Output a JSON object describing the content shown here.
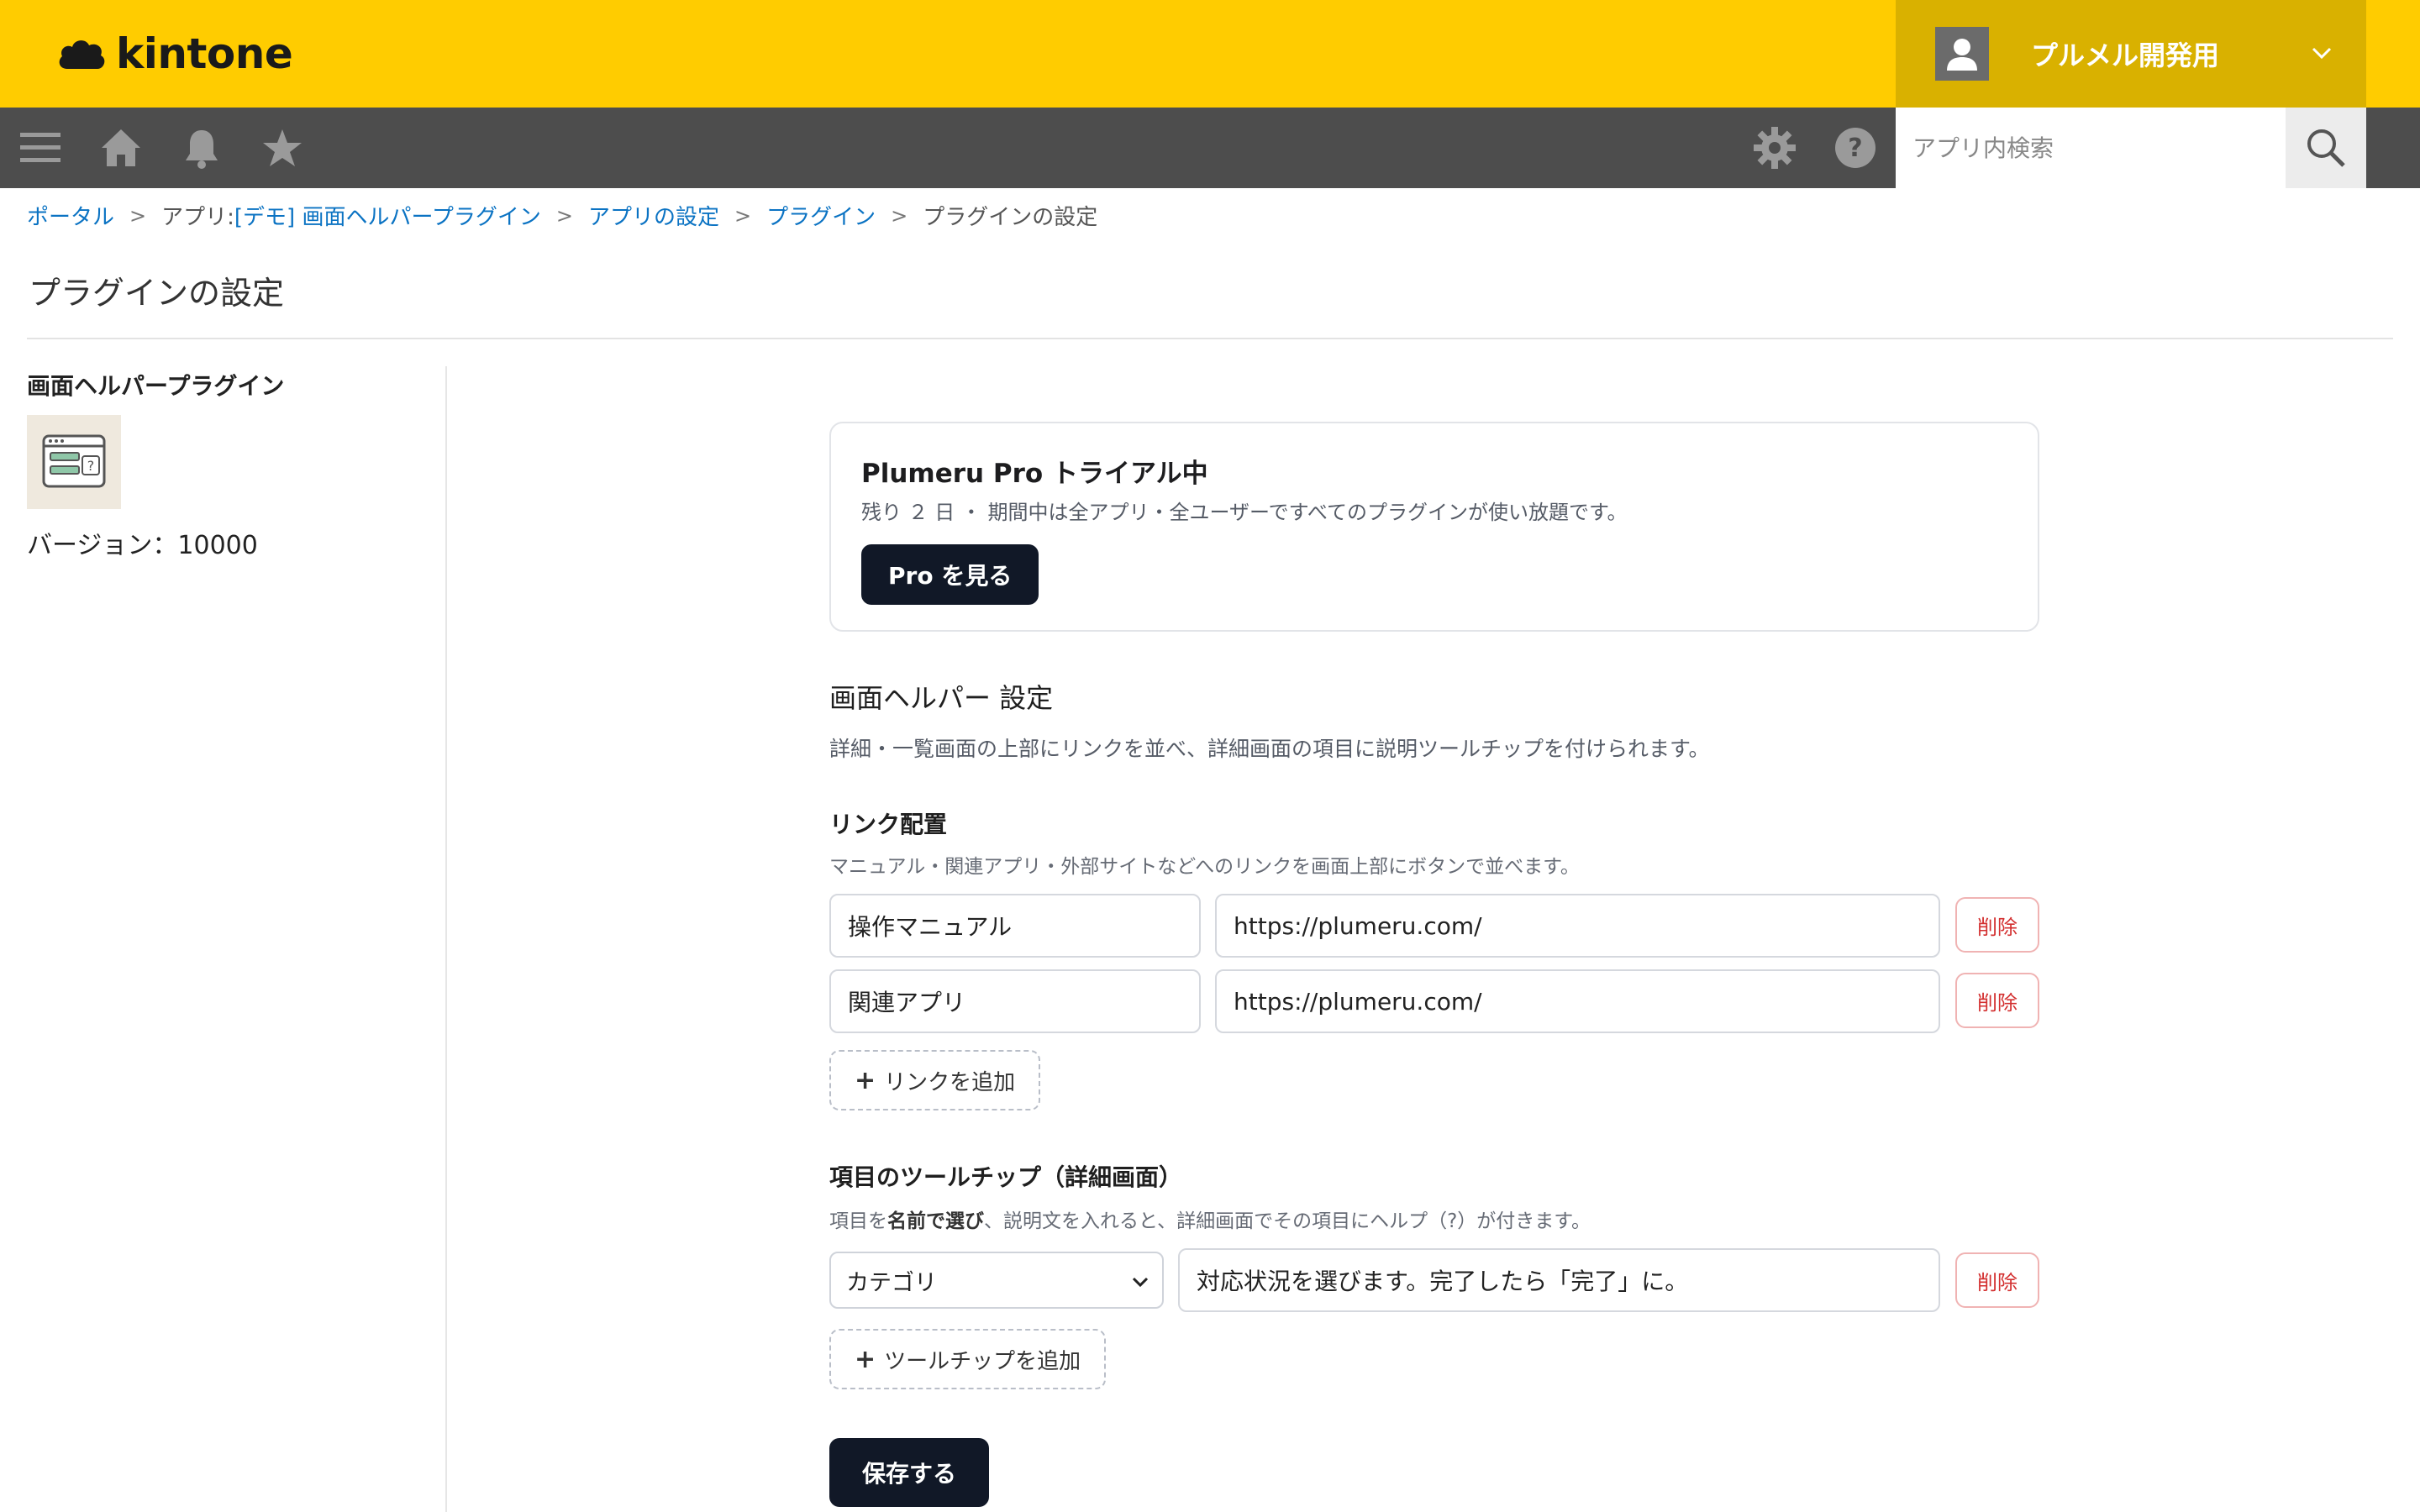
{
  "header": {
    "logo_text": "kintone",
    "user_name": "プルメル開発用"
  },
  "navbar": {
    "icons": [
      "menu-icon",
      "home-icon",
      "bell-icon",
      "star-icon",
      "gear-icon",
      "help-icon"
    ],
    "search_placeholder": "アプリ内検索"
  },
  "breadcrumb": {
    "items": [
      "ポータル",
      "アプリ: [デモ] 画面ヘルパープラグイン",
      "アプリの設定",
      "プラグイン",
      "プラグインの設定"
    ],
    "separator": ">"
  },
  "page_title": "プラグインの設定",
  "plugin_info": {
    "name": "画面ヘルパープラグイン",
    "version": "バージョン：10000"
  },
  "pro_card": {
    "title": "Plumeru Pro トライアル中",
    "subtitle": "残り ２ 日 ・ 期間中は全アプリ・全ユーザーですべてのプラグインが使い放題です。",
    "button_label": "Pro を見る"
  },
  "settings": {
    "title": "画面ヘルパー 設定",
    "description": "詳細・一覧画面の上部にリンクを並べ、詳細画面の項目に説明ツールチップを付けられます。"
  },
  "links_section": {
    "title": "リンク配置",
    "description": "マニュアル・関連アプリ・外部サイトなどへのリンクを画面上部にボタンで並べます。",
    "rows": [
      {
        "label": "操作マニュアル",
        "url": "https://plumeru.com/"
      },
      {
        "label": "関連アプリ",
        "url": "https://plumeru.com/"
      }
    ],
    "delete_label": "削除",
    "add_label": "リンクを追加"
  },
  "tooltip_section": {
    "title": "項目のツールチップ（詳細画面）",
    "description_pre": "項目を",
    "description_bold": "名前で選び",
    "description_post": "、説明文を入れると、詳細画面でその項目にヘルプ（?）が付きます。",
    "rows": [
      {
        "field": "カテゴリ",
        "text": "対応状況を選びます。完了したら「完了」に。"
      }
    ],
    "delete_label": "削除",
    "add_label": "ツールチップを追加"
  },
  "save_label": "保存する",
  "colors": {
    "header_yellow": "#ffcc00",
    "user_box": "#d9b100",
    "nav_dark": "#4d4d4d",
    "link_blue": "#0b73c3",
    "primary_dark": "#111827",
    "delete_red": "#d32f2f"
  }
}
